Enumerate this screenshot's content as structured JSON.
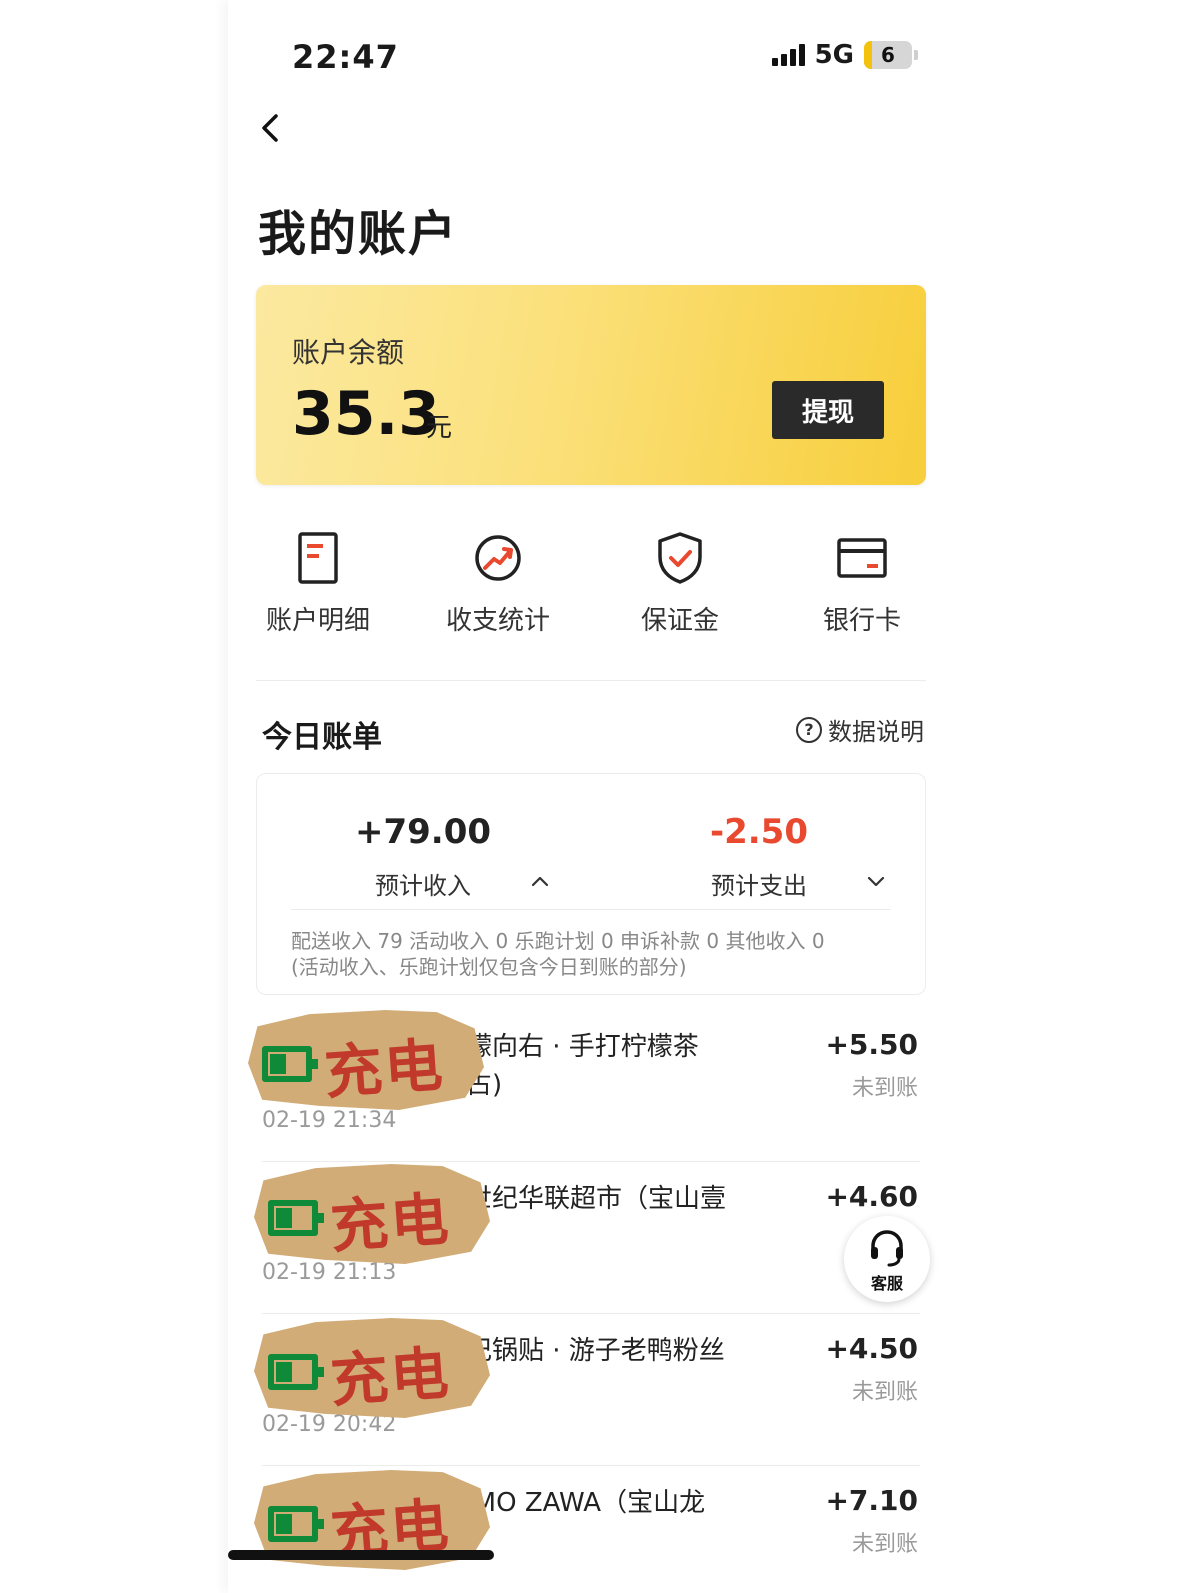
{
  "status_bar": {
    "time": "22:47",
    "network": "5G",
    "battery": "6",
    "battery_level": 0.06
  },
  "header": {
    "title": "我的账户"
  },
  "balance": {
    "label": "账户余额",
    "amount": "35.3",
    "unit": "元",
    "withdraw_label": "提现"
  },
  "quick_actions": [
    {
      "label": "账户明细",
      "icon": "document-icon"
    },
    {
      "label": "收支统计",
      "icon": "trend-chart-icon"
    },
    {
      "label": "保证金",
      "icon": "shield-check-icon"
    },
    {
      "label": "银行卡",
      "icon": "bank-card-icon"
    }
  ],
  "today_bill": {
    "title": "今日账单",
    "explain_label": "数据说明",
    "income": {
      "value": "+79.00",
      "label": "预计收入"
    },
    "expense": {
      "value": "-2.50",
      "label": "预计支出"
    },
    "detail_line1": "配送收入 79  活动收入 0  乐跑计划 0  申诉补款 0  其他收入 0",
    "detail_line2": "(活动收入、乐跑计划仅包含今日到账的部分)"
  },
  "transactions": [
    {
      "name": "檬向右 · 手打柠檬茶",
      "name2": "占)",
      "time": "02-19 21:34",
      "amount": "+5.50",
      "status": "未到账"
    },
    {
      "name": "世纪华联超市（宝山壹",
      "name2": "",
      "time": "02-19 21:13",
      "amount": "+4.60",
      "status": ""
    },
    {
      "name": "记锅贴 · 游子老鸭粉丝",
      "name2": "",
      "time": "02-19 20:42",
      "amount": "+4.50",
      "status": "未到账"
    },
    {
      "name": "IMO ZAWA（宝山龙",
      "name2": "",
      "time": "",
      "amount": "+7.10",
      "status": "未到账"
    }
  ],
  "sticker": {
    "text": "充电"
  },
  "service": {
    "label": "客服"
  },
  "colors": {
    "accent_yellow": "#f7ce3a",
    "expense_red": "#e8492f",
    "icon_red": "#e8492f",
    "dark_button": "#2a2a2a"
  }
}
